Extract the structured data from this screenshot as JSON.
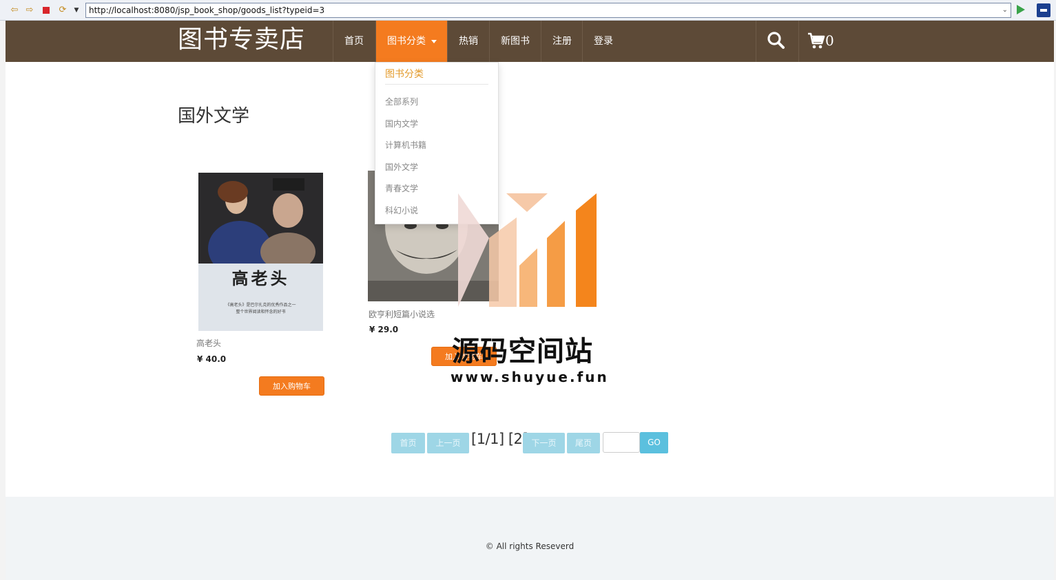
{
  "browser": {
    "url": "http://localhost:8080/jsp_book_shop/goods_list?typeid=3"
  },
  "header": {
    "logo": "图书专卖店",
    "menu": {
      "home": "首页",
      "categories": "图书分类",
      "hot": "热销",
      "new_books": "新图书",
      "register": "注册",
      "login": "登录"
    },
    "cart_count": "0",
    "icons": {
      "search": "search-icon",
      "cart": "cart-icon"
    }
  },
  "dropdown": {
    "header": "图书分类",
    "items": [
      "全部系列",
      "国内文学",
      "计算机书籍",
      "国外文学",
      "青春文学",
      "科幻小说"
    ]
  },
  "main": {
    "category_title": "国外文学",
    "books": [
      {
        "title": "高老头",
        "price": "¥ 40.0",
        "button": "加入购物车",
        "cover_text": "高老头",
        "cover_subtitle": "《高老头》是巴尔扎克的优秀作品之一\n整个世界阅读和怀念的好书"
      },
      {
        "title": "欧亨利短篇小说选",
        "price": "¥ 29.0",
        "button": "加入购物车"
      }
    ]
  },
  "pagination": {
    "first": "首页",
    "prev": "上一页",
    "info": "[1/1] [2]",
    "next": "下一页",
    "last": "尾页",
    "go": "GO"
  },
  "watermark": {
    "title": "源码空间站",
    "url": "www.shuyue.fun"
  },
  "footer": {
    "text": "© All rights Reseverd"
  },
  "colors": {
    "header_bg": "#5d4a37",
    "accent": "#f47b1f",
    "pager": "#9ed6e6",
    "go": "#5bc0de",
    "footer_bg": "#f1f4f6"
  }
}
